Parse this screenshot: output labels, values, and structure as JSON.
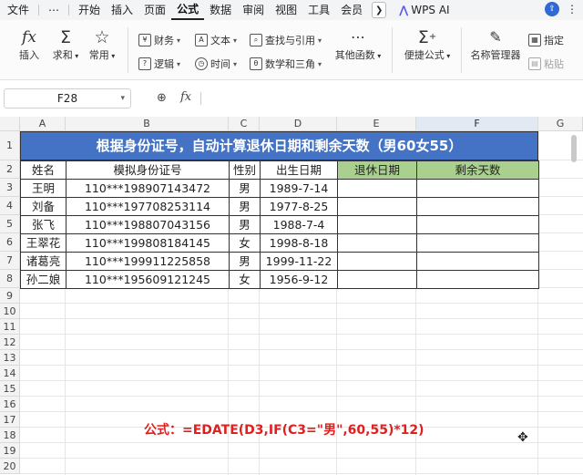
{
  "menubar": {
    "items": [
      "文件",
      "⋯",
      "开始",
      "插入",
      "页面",
      "公式",
      "数据",
      "审阅",
      "视图",
      "工具",
      "会员"
    ],
    "active": "公式",
    "wps_ai": "WPS AI"
  },
  "ribbon": {
    "insert_fn": "插入",
    "sum": "求和",
    "common": "常用",
    "finance": "财务",
    "logic": "逻辑",
    "text": "文本",
    "time": "时间",
    "lookup": "查找与引用",
    "math": "数学和三角",
    "other": "其他函数",
    "quick_formula": "便捷公式",
    "name_manager": "名称管理器",
    "assign": "指定",
    "paste": "粘贴"
  },
  "formula_bar": {
    "cell_ref": "F28",
    "fx": "fx",
    "formula": ""
  },
  "grid": {
    "columns": [
      "A",
      "B",
      "C",
      "D",
      "E",
      "F",
      "G"
    ],
    "selected_column": "F",
    "rows": [
      "1",
      "2",
      "3",
      "4",
      "5",
      "6",
      "7",
      "8",
      "9",
      "10",
      "11",
      "12",
      "13",
      "14",
      "15",
      "16",
      "17",
      "18",
      "19",
      "20"
    ]
  },
  "sheet": {
    "title": "根据身份证号，自动计算退休日期和剩余天数（男60女55）",
    "headers": [
      "姓名",
      "模拟身份证号",
      "性别",
      "出生日期",
      "退休日期",
      "剩余天数"
    ],
    "rows": [
      [
        "王明",
        "110***198907143472",
        "男",
        "1989-7-14",
        "",
        ""
      ],
      [
        "刘备",
        "110***197708253114",
        "男",
        "1977-8-25",
        "",
        ""
      ],
      [
        "张飞",
        "110***198807043156",
        "男",
        "1988-7-4",
        "",
        ""
      ],
      [
        "王翠花",
        "110***199808184145",
        "女",
        "1998-8-18",
        "",
        ""
      ],
      [
        "诸葛亮",
        "110***199911225858",
        "男",
        "1999-11-22",
        "",
        ""
      ],
      [
        "孙二娘",
        "110***195609121245",
        "女",
        "1956-9-12",
        "",
        ""
      ]
    ],
    "formula_note": "公式：=EDATE(D3,IF(C3=\"男\",60,55)*12)"
  },
  "colors": {
    "title_bg": "#4472c4",
    "header_green": "#a9d08e",
    "note_red": "#e02020",
    "wps_ai_accent": "#5b57e8"
  }
}
